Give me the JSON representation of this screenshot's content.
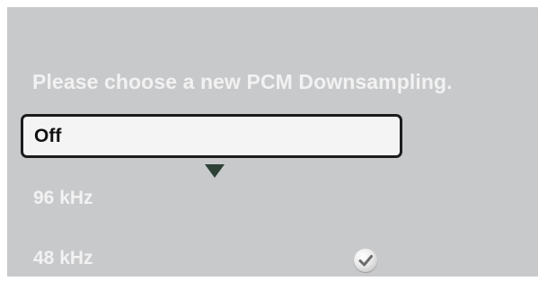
{
  "dialog": {
    "prompt": "Please choose a new PCM Downsampling."
  },
  "options": [
    {
      "label": "Off"
    },
    {
      "label": "96 kHz"
    },
    {
      "label": "48 kHz"
    }
  ],
  "state": {
    "highlighted": "Off",
    "current": "48 kHz"
  },
  "colors": {
    "panel": "#c8c9cb",
    "text": "#f2f2f2",
    "highlight_bg": "#f4f4f4",
    "highlight_border": "#1c1c1c",
    "pointer": "#2d4137"
  },
  "icons": {
    "pointer": "triangle-down-icon",
    "current": "checkmark-icon"
  }
}
